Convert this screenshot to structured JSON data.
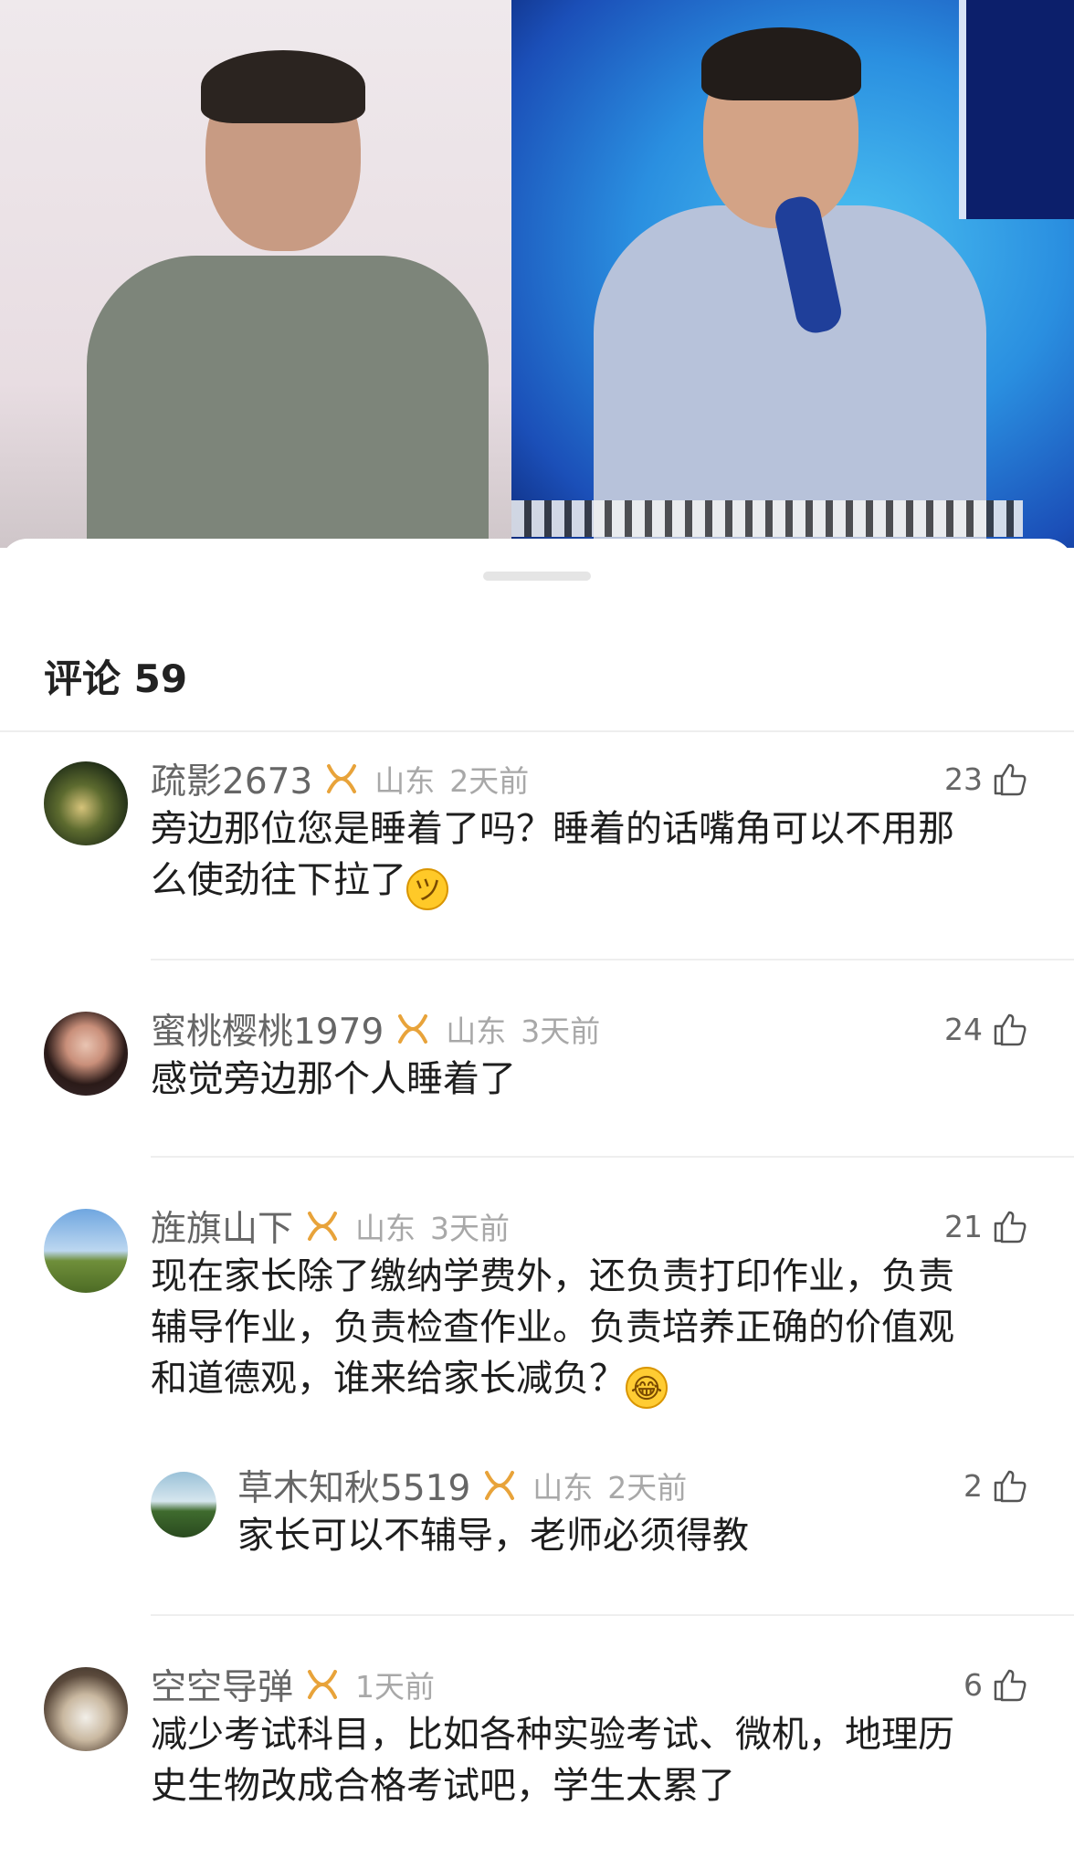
{
  "video": {
    "caption_hint": ""
  },
  "sheet": {
    "title": "评论 59"
  },
  "comments": [
    {
      "user": "疏影2673",
      "region": "山东",
      "time": "2天前",
      "likes": "23",
      "text_line1": "旁边那位您是睡着了吗？睡着的话嘴角可以不用那",
      "text_line2": "么使劲往下拉了",
      "emoji": "grin-emoji"
    },
    {
      "user": "蜜桃樱桃1979",
      "region": "山东",
      "time": "3天前",
      "likes": "24",
      "text_line1": "感觉旁边那个人睡着了"
    },
    {
      "user": "旌旗山下",
      "region": "山东",
      "time": "3天前",
      "likes": "21",
      "text_line1": "现在家长除了缴纳学费外，还负责打印作业，负责",
      "text_line2": "辅导作业，负责检查作业。负责培养正确的价值观",
      "text_line3": "和道德观，谁来给家长减负？",
      "emoji": "laugh-cry-emoji",
      "reply": {
        "user": "草木知秋5519",
        "region": "山东",
        "time": "2天前",
        "likes": "2",
        "text": "家长可以不辅导，老师必须得教"
      }
    },
    {
      "user": "空空导弹",
      "time": "1天前",
      "likes": "6",
      "text_line1": "减少考试科目，比如各种实验考试、微机，地理历",
      "text_line2": "史生物改成合格考试吧，学生太累了"
    }
  ],
  "colors": {
    "badge": "#e8a33a",
    "name": "#666666",
    "meta": "#a8a8a8",
    "text": "#1e1e1e"
  }
}
